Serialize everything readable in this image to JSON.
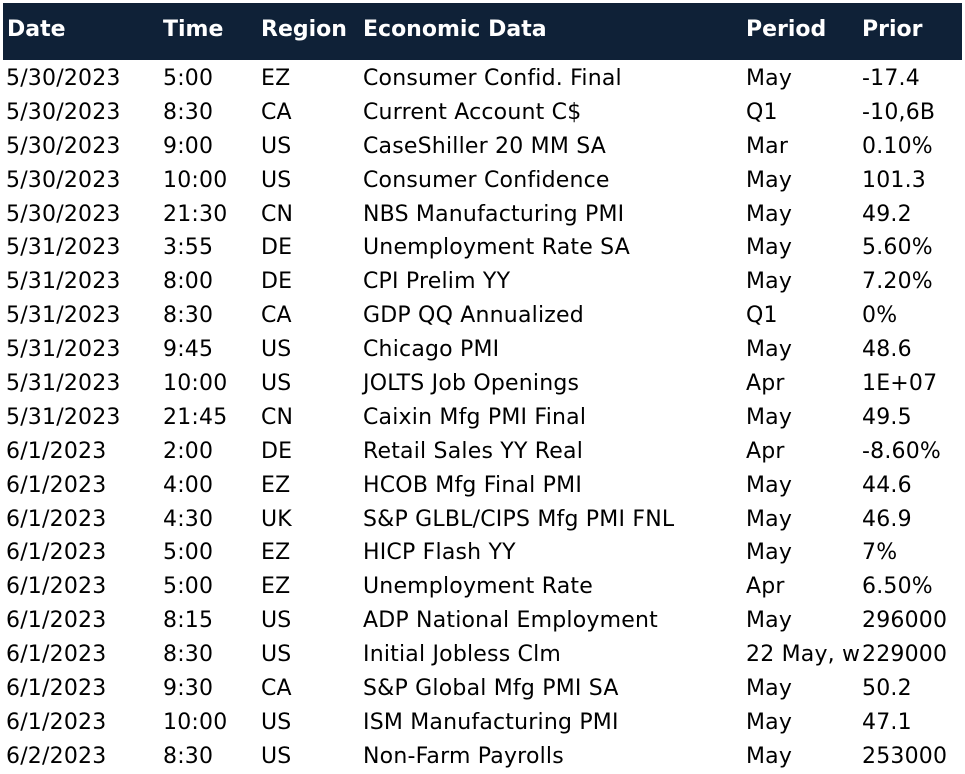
{
  "header": {
    "date": "Date",
    "time": "Time",
    "region": "Region",
    "economic_data": "Economic Data",
    "period": "Period",
    "prior": "Prior"
  },
  "colors": {
    "header_bg": "#0f2137",
    "header_text": "#ffffff",
    "body_text": "#000000"
  },
  "rows": [
    {
      "date": "5/30/2023",
      "time": "5:00",
      "region": "EZ",
      "economic_data": "Consumer Confid. Final",
      "period": "May",
      "prior": "-17.4"
    },
    {
      "date": "5/30/2023",
      "time": "8:30",
      "region": "CA",
      "economic_data": "Current Account C$",
      "period": "Q1",
      "prior": "-10,6B"
    },
    {
      "date": "5/30/2023",
      "time": "9:00",
      "region": "US",
      "economic_data": "CaseShiller 20 MM SA",
      "period": "Mar",
      "prior": "0.10%"
    },
    {
      "date": "5/30/2023",
      "time": "10:00",
      "region": "US",
      "economic_data": "Consumer Confidence",
      "period": "May",
      "prior": "101.3"
    },
    {
      "date": "5/30/2023",
      "time": "21:30",
      "region": "CN",
      "economic_data": "NBS Manufacturing PMI",
      "period": "May",
      "prior": "49.2"
    },
    {
      "date": "5/31/2023",
      "time": "3:55",
      "region": "DE",
      "economic_data": "Unemployment Rate SA",
      "period": "May",
      "prior": "5.60%"
    },
    {
      "date": "5/31/2023",
      "time": "8:00",
      "region": "DE",
      "economic_data": "CPI Prelim YY",
      "period": "May",
      "prior": "7.20%"
    },
    {
      "date": "5/31/2023",
      "time": "8:30",
      "region": "CA",
      "economic_data": "GDP QQ Annualized",
      "period": "Q1",
      "prior": "0%"
    },
    {
      "date": "5/31/2023",
      "time": "9:45",
      "region": "US",
      "economic_data": "Chicago PMI",
      "period": "May",
      "prior": "48.6"
    },
    {
      "date": "5/31/2023",
      "time": "10:00",
      "region": "US",
      "economic_data": "JOLTS Job Openings",
      "period": "Apr",
      "prior": "1E+07"
    },
    {
      "date": "5/31/2023",
      "time": "21:45",
      "region": "CN",
      "economic_data": "Caixin Mfg PMI Final",
      "period": "May",
      "prior": "49.5"
    },
    {
      "date": "6/1/2023",
      "time": "2:00",
      "region": "DE",
      "economic_data": "Retail Sales YY Real",
      "period": "Apr",
      "prior": "-8.60%"
    },
    {
      "date": "6/1/2023",
      "time": "4:00",
      "region": "EZ",
      "economic_data": "HCOB Mfg Final PMI",
      "period": "May",
      "prior": "44.6"
    },
    {
      "date": "6/1/2023",
      "time": "4:30",
      "region": "UK",
      "economic_data": "S&P GLBL/CIPS Mfg PMI FNL",
      "period": "May",
      "prior": "46.9"
    },
    {
      "date": "6/1/2023",
      "time": "5:00",
      "region": "EZ",
      "economic_data": "HICP Flash YY",
      "period": "May",
      "prior": "7%"
    },
    {
      "date": "6/1/2023",
      "time": "5:00",
      "region": "EZ",
      "economic_data": "Unemployment Rate",
      "period": "Apr",
      "prior": "6.50%"
    },
    {
      "date": "6/1/2023",
      "time": "8:15",
      "region": "US",
      "economic_data": "ADP National Employment",
      "period": "May",
      "prior": "296000"
    },
    {
      "date": "6/1/2023",
      "time": "8:30",
      "region": "US",
      "economic_data": "Initial Jobless Clm",
      "period": "22 May, w",
      "prior": "229000"
    },
    {
      "date": "6/1/2023",
      "time": "9:30",
      "region": "CA",
      "economic_data": "S&P Global Mfg PMI SA",
      "period": "May",
      "prior": "50.2"
    },
    {
      "date": "6/1/2023",
      "time": "10:00",
      "region": "US",
      "economic_data": "ISM Manufacturing PMI",
      "period": "May",
      "prior": "47.1"
    },
    {
      "date": "6/2/2023",
      "time": "8:30",
      "region": "US",
      "economic_data": "Non-Farm Payrolls",
      "period": "May",
      "prior": "253000"
    }
  ]
}
